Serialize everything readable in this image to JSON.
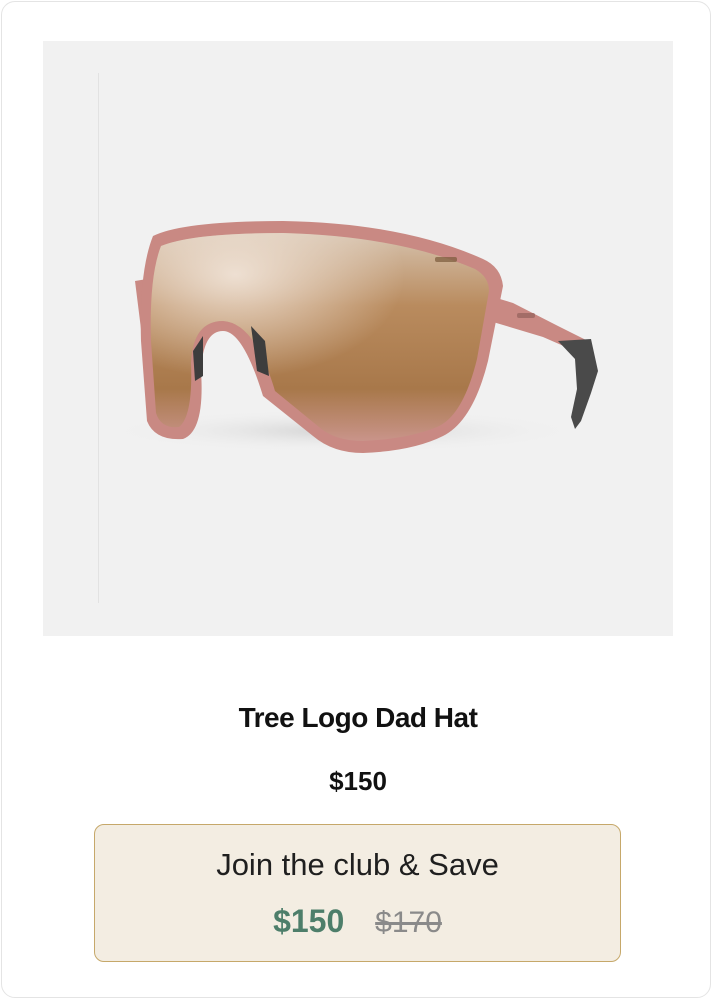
{
  "product": {
    "image_alt": "sunglasses-product-image",
    "title": "Tree Logo Dad Hat",
    "price": "$150"
  },
  "club_offer": {
    "label": "Join the club & Save",
    "club_price": "$150",
    "original_price": "$170"
  },
  "colors": {
    "frame": "#c98983",
    "lens": "#b48555",
    "club_bg": "#f3ede2",
    "club_border": "#c6a86a",
    "club_price": "#4d7e6a",
    "orig_price": "#8a8a8a"
  }
}
